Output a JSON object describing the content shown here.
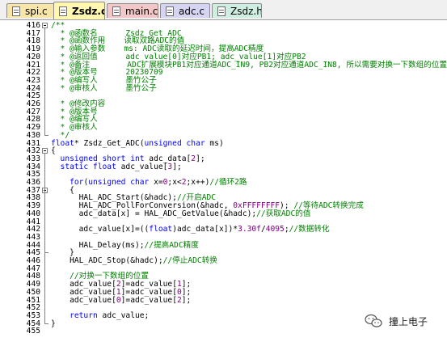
{
  "tabs": [
    {
      "label": "spi.c",
      "color": "#f7e6a8"
    },
    {
      "label": "Zsdz.c*",
      "color": "#fff6b0",
      "active": true
    },
    {
      "label": "main.c",
      "color": "#f3c7c7"
    },
    {
      "label": "adc.c",
      "color": "#d5d5f3"
    },
    {
      "label": "Zsdz.h",
      "color": "#cdeee0"
    }
  ],
  "code_lines": [
    {
      "n": "416",
      "fold": "box",
      "segs": [
        [
          "c",
          "/**"
        ]
      ]
    },
    {
      "n": "417",
      "segs": [
        [
          "c",
          "  * @函数名      Zsdz_Get_ADC"
        ]
      ]
    },
    {
      "n": "418",
      "segs": [
        [
          "c",
          "  * @函数作用    读取双路ADC的值"
        ]
      ]
    },
    {
      "n": "419",
      "segs": [
        [
          "c",
          "  * @输入参数    ms: ADC读取的延迟时间，提高ADC精度"
        ]
      ]
    },
    {
      "n": "420",
      "segs": [
        [
          "c",
          "  * @返回值      adc_value[0]对应PB1; adc_value[1]对应PB2"
        ]
      ]
    },
    {
      "n": "421",
      "segs": [
        [
          "c",
          "  * @备注        ADC扩展模块PB1对应通道ADC_IN9, PB2对应通道ADC_IN8, 所以需要对换一下数组的位置"
        ]
      ]
    },
    {
      "n": "422",
      "segs": [
        [
          "c",
          "  * @版本号      20230709"
        ]
      ]
    },
    {
      "n": "423",
      "segs": [
        [
          "c",
          "  * @编写人      墨竹公子"
        ]
      ]
    },
    {
      "n": "424",
      "segs": [
        [
          "c",
          "  * @审核人      墨竹公子"
        ]
      ]
    },
    {
      "n": "425",
      "segs": [
        [
          "c",
          ""
        ]
      ]
    },
    {
      "n": "426",
      "segs": [
        [
          "c",
          "  * @修改内容"
        ]
      ]
    },
    {
      "n": "427",
      "segs": [
        [
          "c",
          "  * @版本号"
        ]
      ]
    },
    {
      "n": "428",
      "segs": [
        [
          "c",
          "  * @编写人"
        ]
      ]
    },
    {
      "n": "429",
      "segs": [
        [
          "c",
          "  * @审核人"
        ]
      ]
    },
    {
      "n": "430",
      "fold": "end",
      "segs": [
        [
          "c",
          "  */"
        ]
      ]
    },
    {
      "n": "431",
      "segs": [
        [
          "kw",
          "float"
        ],
        [
          "pl",
          "* Zsdz_Get_ADC("
        ],
        [
          "kw",
          "unsigned char"
        ],
        [
          "pl",
          " ms)"
        ]
      ]
    },
    {
      "n": "432",
      "fold": "box",
      "segs": [
        [
          "pl",
          "{"
        ]
      ]
    },
    {
      "n": "433",
      "segs": [
        [
          "kw",
          "  unsigned short int"
        ],
        [
          "pl",
          " adc_data["
        ],
        [
          "num",
          "2"
        ],
        [
          "pl",
          "];"
        ]
      ]
    },
    {
      "n": "434",
      "segs": [
        [
          "kw",
          "  static float"
        ],
        [
          "pl",
          " adc_value["
        ],
        [
          "num",
          "3"
        ],
        [
          "pl",
          "];"
        ]
      ]
    },
    {
      "n": "435",
      "segs": [
        [
          "pl",
          ""
        ]
      ]
    },
    {
      "n": "436",
      "segs": [
        [
          "kw",
          "    for"
        ],
        [
          "pl",
          "("
        ],
        [
          "kw",
          "unsigned char"
        ],
        [
          "pl",
          " x="
        ],
        [
          "num",
          "0"
        ],
        [
          "pl",
          ";x<"
        ],
        [
          "num",
          "2"
        ],
        [
          "pl",
          ";x++)"
        ],
        [
          "c",
          "//循环2路"
        ]
      ]
    },
    {
      "n": "437",
      "fold": "box",
      "segs": [
        [
          "pl",
          "    {"
        ]
      ]
    },
    {
      "n": "438",
      "segs": [
        [
          "pl",
          "      HAL_ADC_Start(&hadc);"
        ],
        [
          "c",
          "//开启ADC"
        ]
      ]
    },
    {
      "n": "439",
      "segs": [
        [
          "pl",
          "      HAL_ADC_PollForConversion(&hadc, "
        ],
        [
          "num",
          "0xFFFFFFFF"
        ],
        [
          "pl",
          "); "
        ],
        [
          "c",
          "//等待ADC转换完成"
        ]
      ]
    },
    {
      "n": "440",
      "segs": [
        [
          "pl",
          "      adc_data[x] = HAL_ADC_GetValue(&hadc);"
        ],
        [
          "c",
          "//获取ADC的值"
        ]
      ]
    },
    {
      "n": "441",
      "segs": [
        [
          "pl",
          ""
        ]
      ]
    },
    {
      "n": "442",
      "segs": [
        [
          "pl",
          "      adc_value[x]=(("
        ],
        [
          "kw",
          "float"
        ],
        [
          "pl",
          ")adc_data[x])*"
        ],
        [
          "num",
          "3.30f"
        ],
        [
          "pl",
          "/"
        ],
        [
          "num",
          "4095"
        ],
        [
          "pl",
          ";"
        ],
        [
          "c",
          "//数据转化"
        ]
      ]
    },
    {
      "n": "443",
      "segs": [
        [
          "pl",
          ""
        ]
      ]
    },
    {
      "n": "444",
      "segs": [
        [
          "pl",
          "      HAL_Delay(ms);"
        ],
        [
          "c",
          "//提高ADC精度"
        ]
      ]
    },
    {
      "n": "445",
      "fold": "end",
      "segs": [
        [
          "pl",
          "    }"
        ]
      ]
    },
    {
      "n": "446",
      "segs": [
        [
          "pl",
          "    HAL_ADC_Stop(&hadc);"
        ],
        [
          "c",
          "//停止ADC转换"
        ]
      ]
    },
    {
      "n": "447",
      "segs": [
        [
          "pl",
          ""
        ]
      ]
    },
    {
      "n": "448",
      "segs": [
        [
          "c",
          "    //对换一下数组的位置"
        ]
      ]
    },
    {
      "n": "449",
      "segs": [
        [
          "pl",
          "    adc_value["
        ],
        [
          "num",
          "2"
        ],
        [
          "pl",
          "]=adc_value["
        ],
        [
          "num",
          "1"
        ],
        [
          "pl",
          "];"
        ]
      ]
    },
    {
      "n": "450",
      "segs": [
        [
          "pl",
          "    adc_value["
        ],
        [
          "num",
          "1"
        ],
        [
          "pl",
          "]=adc_value["
        ],
        [
          "num",
          "0"
        ],
        [
          "pl",
          "];"
        ]
      ]
    },
    {
      "n": "451",
      "segs": [
        [
          "pl",
          "    adc_value["
        ],
        [
          "num",
          "0"
        ],
        [
          "pl",
          "]=adc_value["
        ],
        [
          "num",
          "2"
        ],
        [
          "pl",
          "];"
        ]
      ]
    },
    {
      "n": "452",
      "segs": [
        [
          "pl",
          ""
        ]
      ]
    },
    {
      "n": "453",
      "segs": [
        [
          "kw",
          "    return"
        ],
        [
          "pl",
          " adc_value;"
        ]
      ]
    },
    {
      "n": "454",
      "fold": "end",
      "segs": [
        [
          "pl",
          "}"
        ]
      ]
    },
    {
      "n": "455",
      "segs": [
        [
          "pl",
          ""
        ]
      ]
    }
  ],
  "watermark": {
    "text": "撞上电子",
    "icon": "wechat-logo-icon"
  },
  "colors": {
    "comment": "#008000",
    "keyword": "#0000ff",
    "number": "#800080"
  }
}
